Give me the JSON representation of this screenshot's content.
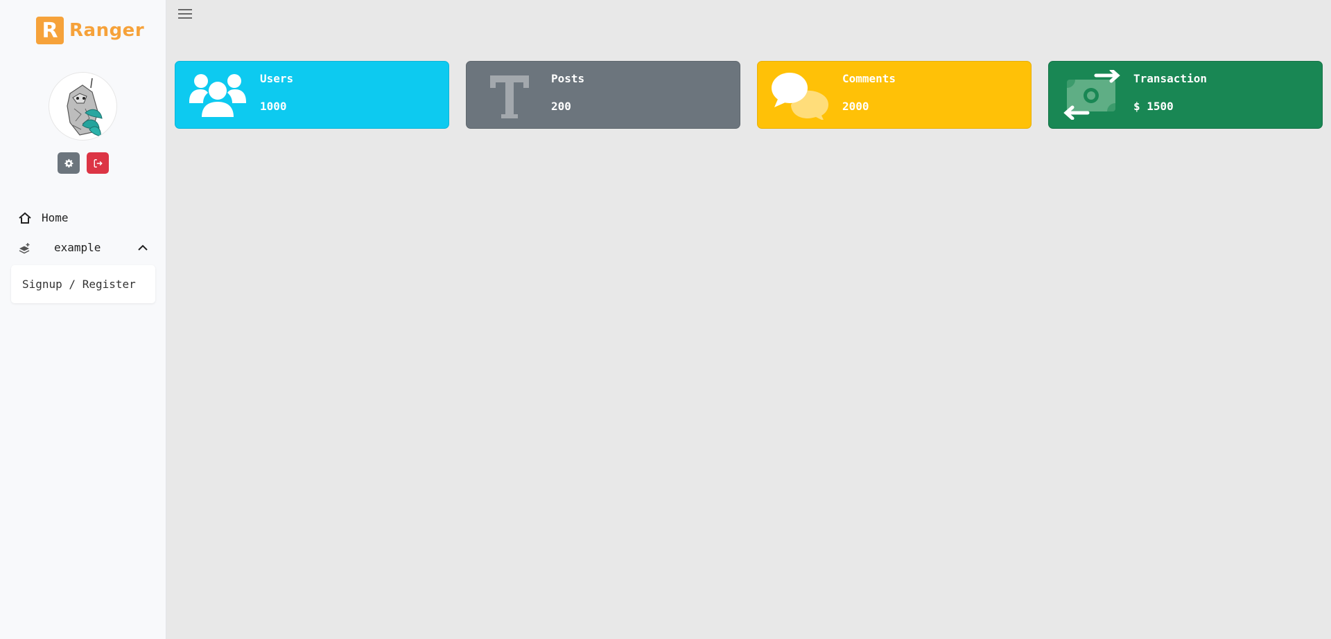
{
  "brand": {
    "logo_letter": "R",
    "name": "Ranger",
    "color": "#f6a23a"
  },
  "sidebar": {
    "avatar_icon": "sloth-avatar",
    "settings_icon": "gear-icon",
    "logout_icon": "logout-icon",
    "nav": [
      {
        "label": "Home",
        "icon": "home-icon"
      },
      {
        "label": "example",
        "icon": "layers-icon",
        "expanded": true,
        "children": [
          {
            "label": "Signup / Register"
          }
        ]
      }
    ]
  },
  "header": {
    "menu_icon": "hamburger-icon"
  },
  "cards": [
    {
      "title": "Users",
      "value": "1000",
      "icon": "users-icon",
      "color": "#0dcaf0"
    },
    {
      "title": "Posts",
      "value": "200",
      "icon": "text-icon",
      "color": "#6c757d"
    },
    {
      "title": "Comments",
      "value": "2000",
      "icon": "comments-icon",
      "color": "#ffc107"
    },
    {
      "title": "Transaction",
      "value": "$ 1500",
      "icon": "money-exchange-icon",
      "color": "#198754"
    }
  ]
}
